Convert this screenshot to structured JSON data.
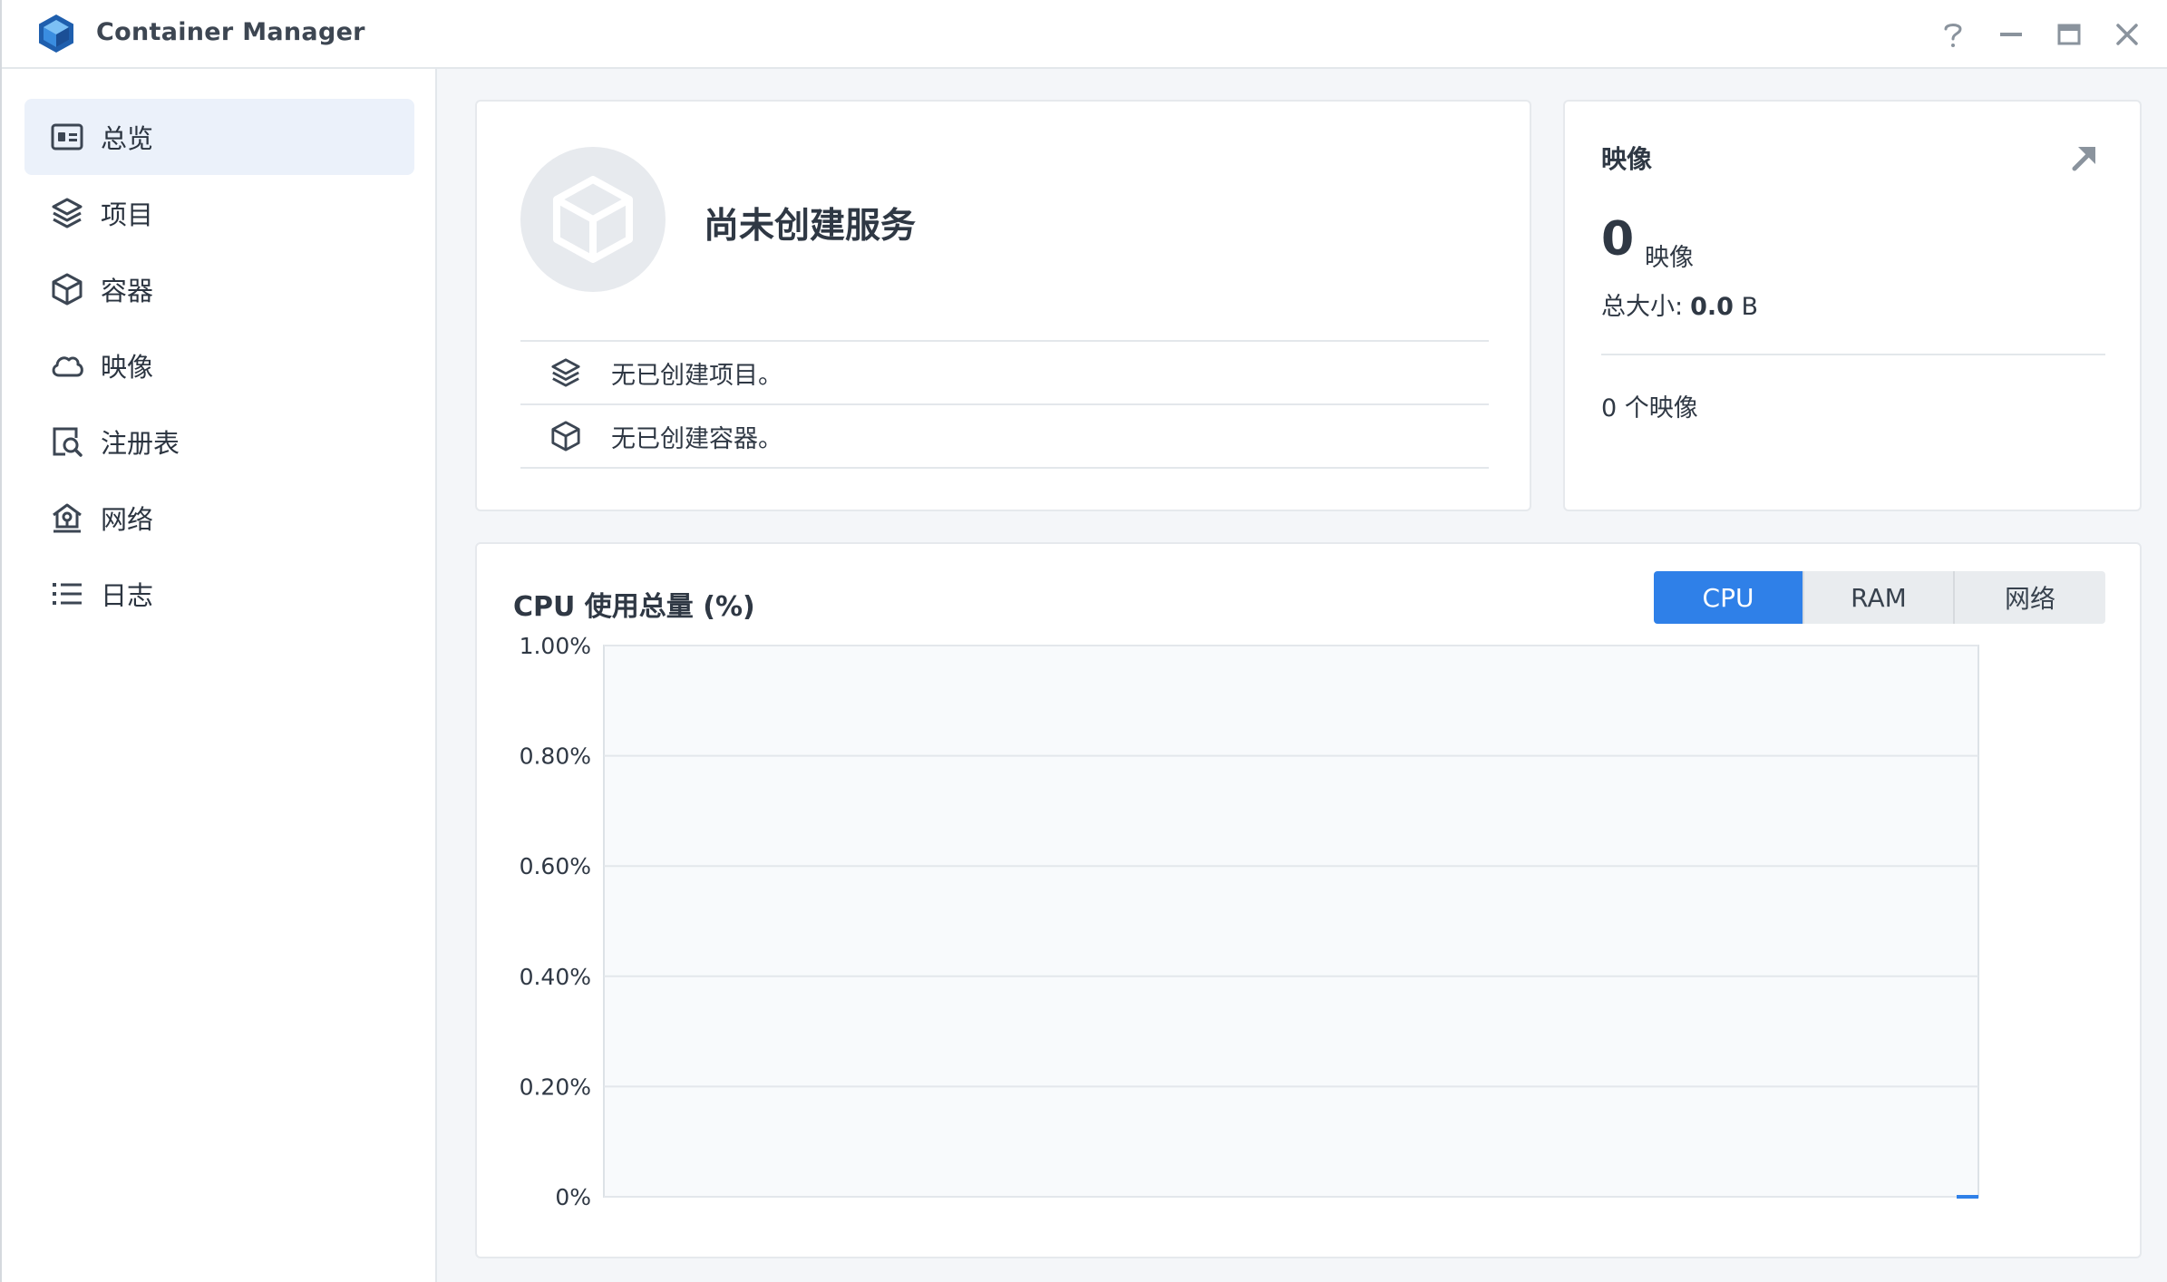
{
  "app": {
    "title": "Container Manager"
  },
  "sidebar": {
    "items": [
      {
        "label": "总览",
        "icon": "overview-icon",
        "active": true
      },
      {
        "label": "项目",
        "icon": "layers-icon"
      },
      {
        "label": "容器",
        "icon": "cube-icon"
      },
      {
        "label": "映像",
        "icon": "cloud-icon"
      },
      {
        "label": "注册表",
        "icon": "registry-search-icon"
      },
      {
        "label": "网络",
        "icon": "network-home-icon"
      },
      {
        "label": "日志",
        "icon": "list-icon"
      }
    ]
  },
  "services": {
    "title": "尚未创建服务",
    "rows": [
      {
        "text": "无已创建项目。",
        "icon": "layers-icon"
      },
      {
        "text": "无已创建容器。",
        "icon": "cube-icon"
      }
    ]
  },
  "images": {
    "heading": "映像",
    "count": "0",
    "count_unit": "映像",
    "size_label": "总大小:",
    "size_value": "0.0",
    "size_unit": "B",
    "note": "0 个映像"
  },
  "usage": {
    "title": "CPU 使用总量 (%)",
    "tabs": [
      {
        "label": "CPU",
        "active": true
      },
      {
        "label": "RAM"
      },
      {
        "label": "网络"
      }
    ]
  },
  "colors": {
    "accent": "#2f80e8",
    "grid": "#e3e7eb",
    "plot_bg": "#f8fafc"
  },
  "chart_data": {
    "type": "line",
    "ylabel_ticks": [
      "1.00%",
      "0.80%",
      "0.60%",
      "0.40%",
      "0.20%",
      "0%"
    ],
    "ylim": [
      0,
      1
    ],
    "series": [
      {
        "values": [
          0,
          0
        ]
      }
    ],
    "grid": true
  }
}
